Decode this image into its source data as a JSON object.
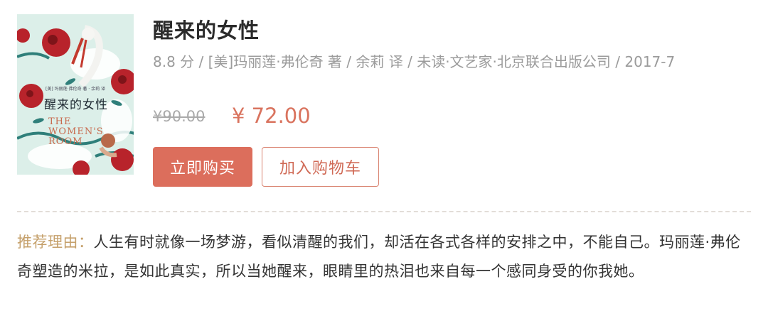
{
  "book": {
    "title": "醒来的女性",
    "meta": "8.8 分 / [美]玛丽莲·弗伦奇 著 / 余莉 译 / 未读·文艺家·北京联合出版公司 / 2017-7",
    "cover": {
      "title": "醒来的女性",
      "author": "[美] 玛丽莲·弗伦奇 著 · 余莉 译",
      "english": "THE\nWOMEN'S\nROOM"
    }
  },
  "price": {
    "original": "¥90.00",
    "current": "¥ 72.00"
  },
  "actions": {
    "buy_label": "立即购买",
    "cart_label": "加入购物车"
  },
  "recommendation": {
    "label": "推荐理由：",
    "text": "人生有时就像一场梦游，看似清醒的我们，却活在各式各样的安排之中，不能自己。玛丽莲·弗伦奇塑造的米拉，是如此真实，所以当她醒来，眼睛里的热泪也来自每一个感同身受的你我她。"
  },
  "colors": {
    "accent": "#dc6e5c",
    "label_gold": "#c5a06b",
    "cover_bg": "#dcefe9",
    "cover_red": "#b8232b"
  }
}
